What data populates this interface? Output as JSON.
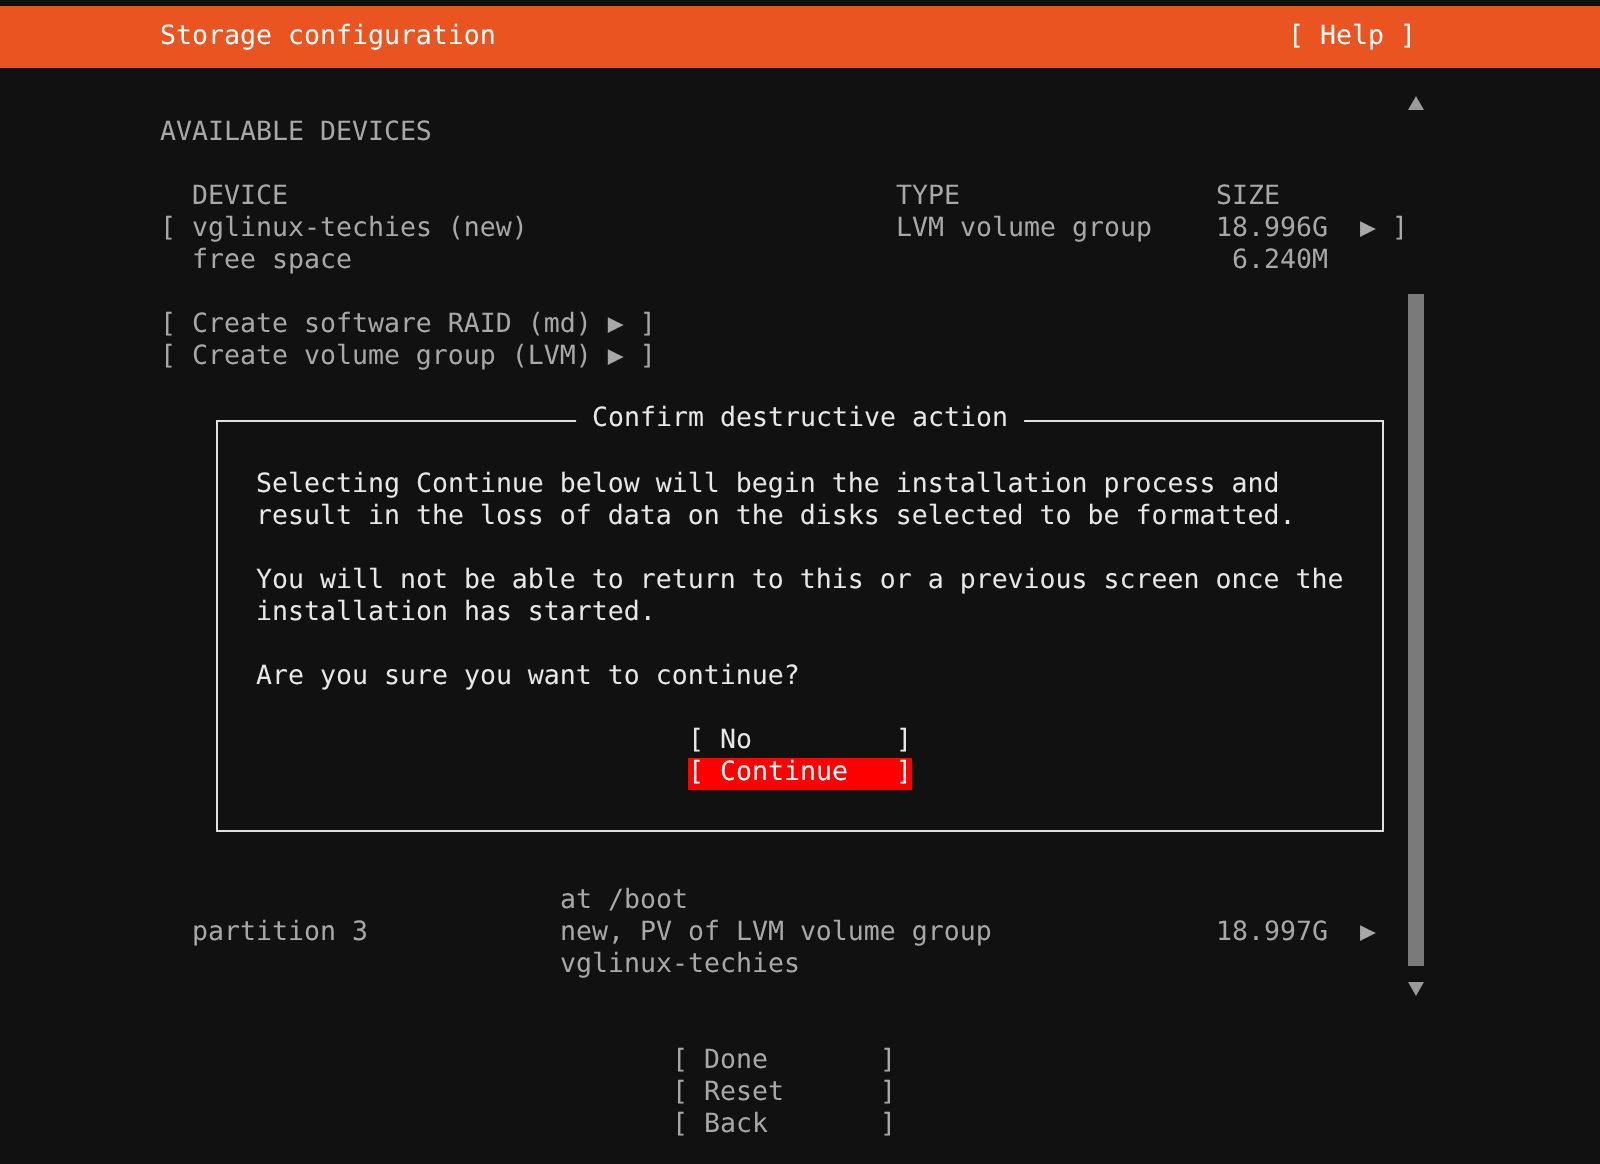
{
  "header": {
    "title": "Storage configuration",
    "help": "[ Help ]"
  },
  "section": "AVAILABLE DEVICES",
  "columns": [
    "DEVICE",
    "TYPE",
    "SIZE"
  ],
  "devices": [
    {
      "kind": "device",
      "lead": "[",
      "name": "vglinux-techies (new)",
      "type": "LVM volume group",
      "size": "18.996G",
      "tail": "▶ ]"
    },
    {
      "kind": "free",
      "name": "free space",
      "size": "6.240M"
    }
  ],
  "actions": [
    "[ Create software RAID (md) ▶ ]",
    "[ Create volume group (LVM) ▶ ]"
  ],
  "partition": {
    "name": "partition 3",
    "type_lines": [
      "at /boot",
      "new, PV of LVM volume group",
      "vglinux-techies"
    ],
    "size": "18.997G",
    "tail": "▶"
  },
  "dialog": {
    "title": "Confirm destructive action",
    "paragraphs": [
      [
        "Selecting Continue below will begin the installation process and",
        "result in the loss of data on the disks selected to be formatted."
      ],
      [
        "You will not be able to return to this or a previous screen once the",
        "installation has started."
      ],
      [
        "Are you sure you want to continue?"
      ]
    ],
    "buttons": [
      {
        "label": "[ No         ]",
        "selected": false
      },
      {
        "label": "[ Continue   ]",
        "selected": true
      }
    ]
  },
  "buttons": [
    "[ Done       ]",
    "[ Reset      ]",
    "[ Back       ]"
  ]
}
